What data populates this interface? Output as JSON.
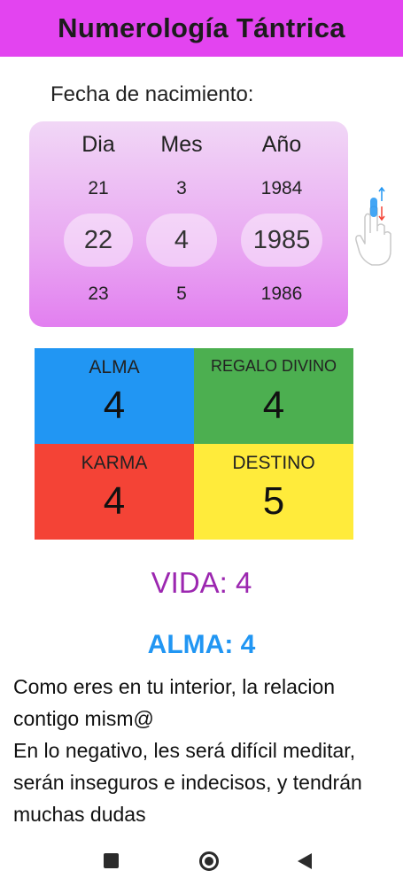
{
  "app": {
    "title": "Numerología Tántrica"
  },
  "birth": {
    "label": "Fecha de nacimiento:"
  },
  "picker": {
    "columns": [
      {
        "header": "Dia",
        "prev": "21",
        "selected": "22",
        "next": "23"
      },
      {
        "header": "Mes",
        "prev": "3",
        "selected": "4",
        "next": "5"
      },
      {
        "header": "Año",
        "prev": "1984",
        "selected": "1985",
        "next": "1986"
      }
    ]
  },
  "grid": {
    "alma": {
      "label": "ALMA",
      "value": "4",
      "color": "#2196f3"
    },
    "regalo": {
      "label": "REGALO DIVINO",
      "value": "4",
      "color": "#4caf50"
    },
    "karma": {
      "label": "KARMA",
      "value": "4",
      "color": "#f44336"
    },
    "destino": {
      "label": "DESTINO",
      "value": "5",
      "color": "#ffeb3b"
    }
  },
  "vida": {
    "text": "VIDA: 4",
    "color": "#9c27b0"
  },
  "detail": {
    "title": "ALMA: 4",
    "lines": [
      "Como eres en tu interior, la relacion contigo mism@",
      "En lo negativo, les será difícil meditar, serán inseguros e indecisos, y tendrán muchas dudas"
    ]
  },
  "icons": {
    "swipe": "swipe-vertical-hand-icon",
    "recents": "square-recents-icon",
    "home": "circle-home-icon",
    "back": "triangle-back-icon"
  }
}
